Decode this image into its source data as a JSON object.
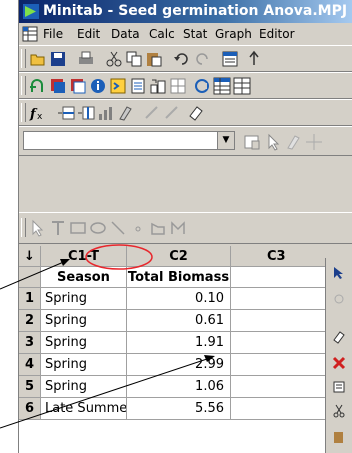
{
  "window": {
    "title": "Minitab - Seed germination Anova.MPJ -"
  },
  "menu": [
    "File",
    "Edit",
    "Data",
    "Calc",
    "Stat",
    "Graph",
    "Editor"
  ],
  "toolbar_icons": {
    "row1": [
      "open-icon",
      "save-icon",
      "print-icon",
      "cut-icon",
      "copy-icon",
      "paste-icon",
      "undo-icon",
      "redo-icon",
      "session-icon",
      "up-icon"
    ],
    "row2": [
      "project-icon",
      "worksheet-icon",
      "graph-icon",
      "info-icon",
      "history-icon",
      "report-icon",
      "datawin-icon",
      "layout-icon",
      "close-graphs-icon",
      "grid-icon",
      "table-icon"
    ],
    "row3": [
      "fx-icon",
      "insert-row-icon",
      "insert-col-icon",
      "chart-icon",
      "brush-icon",
      "disabled-icon",
      "disabled-icon",
      "eraser-icon"
    ],
    "row4": [
      "combo-dropdown-icon",
      "properties-icon",
      "pointer-icon",
      "brush-icon",
      "crosshair-icon"
    ],
    "row5": [
      "pointer-icon",
      "text-tool-icon",
      "rectangle-icon",
      "ellipse-icon",
      "line-icon",
      "dot-icon",
      "polygon-icon",
      "polyline-icon"
    ]
  },
  "worksheet": {
    "arrow_header": "↓",
    "columns": [
      {
        "id": "C1-T",
        "name": "Season"
      },
      {
        "id": "C2",
        "name": "Total Biomass"
      },
      {
        "id": "C3",
        "name": ""
      }
    ],
    "rows": [
      {
        "n": "1",
        "season": "Spring",
        "biomass": "0.10"
      },
      {
        "n": "2",
        "season": "Spring",
        "biomass": "0.61"
      },
      {
        "n": "3",
        "season": "Spring",
        "biomass": "1.91"
      },
      {
        "n": "4",
        "season": "Spring",
        "biomass": "2.99"
      },
      {
        "n": "5",
        "season": "Spring",
        "biomass": "1.06"
      },
      {
        "n": "6",
        "season": "Late Summer",
        "biomass": "5.56"
      }
    ]
  },
  "annotations": {
    "highlight_color": "#e8262c",
    "arrow_color": "#000000"
  }
}
